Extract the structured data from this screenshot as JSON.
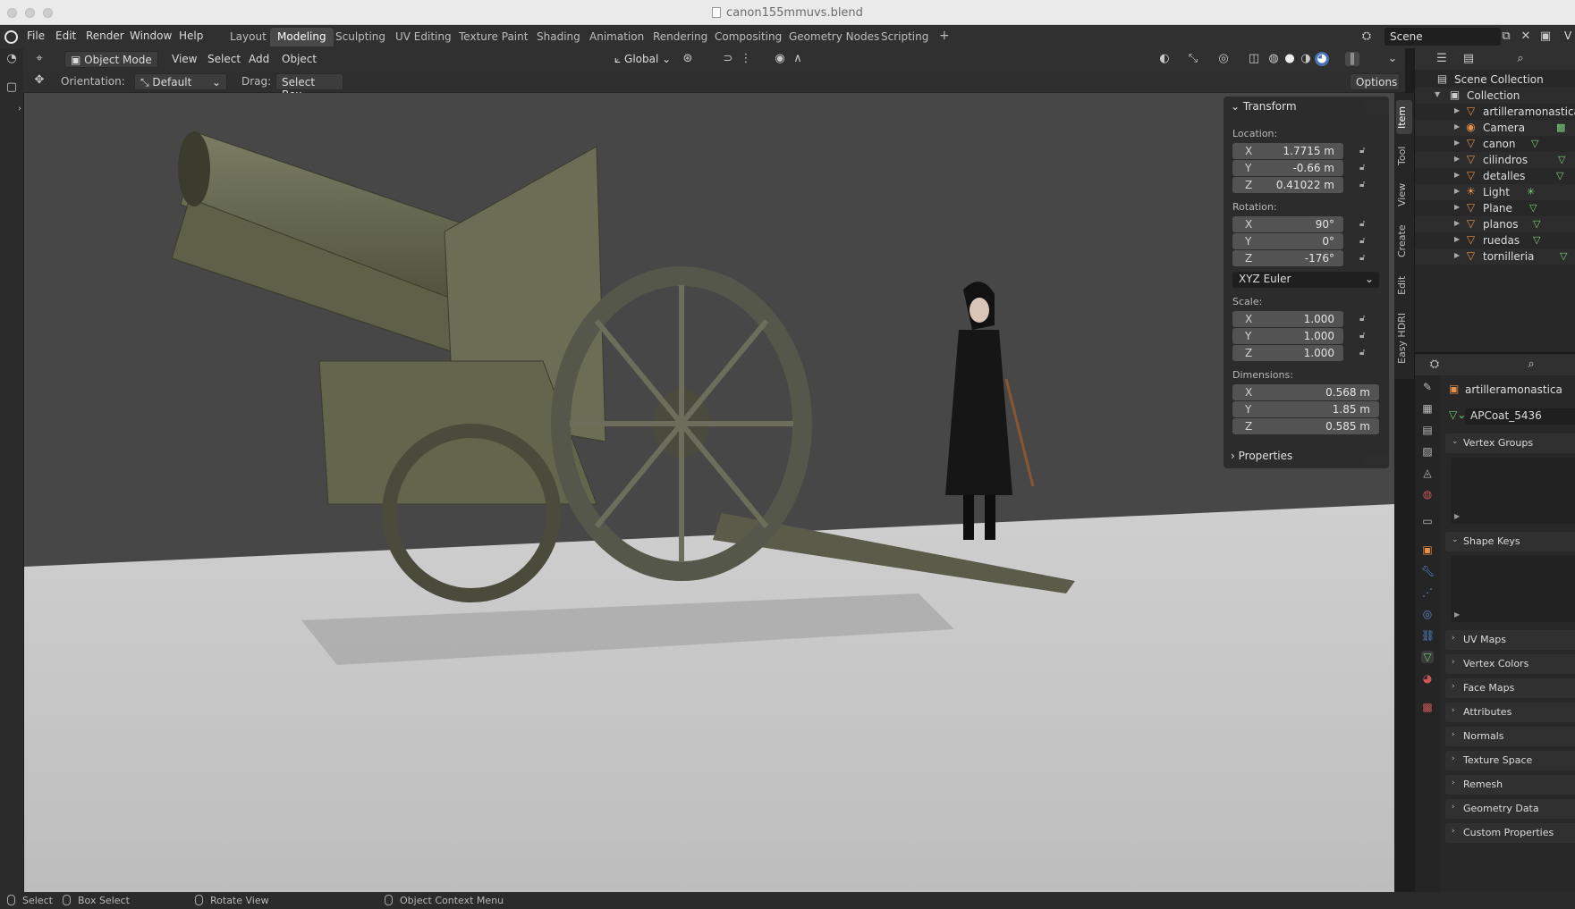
{
  "window": {
    "title": "canon155mmuvs.blend"
  },
  "menus": [
    "File",
    "Edit",
    "Render",
    "Window",
    "Help"
  ],
  "workspaces": [
    {
      "label": "Layout",
      "active": false
    },
    {
      "label": "Modeling",
      "active": true
    },
    {
      "label": "Sculpting",
      "active": false
    },
    {
      "label": "UV Editing",
      "active": false
    },
    {
      "label": "Texture Paint",
      "active": false
    },
    {
      "label": "Shading",
      "active": false
    },
    {
      "label": "Animation",
      "active": false
    },
    {
      "label": "Rendering",
      "active": false
    },
    {
      "label": "Compositing",
      "active": false
    },
    {
      "label": "Geometry Nodes",
      "active": false
    },
    {
      "label": "Scripting",
      "active": false
    }
  ],
  "workspace_add": "+",
  "scene": {
    "name": "Scene",
    "viewlayer_abbr": "V"
  },
  "header": {
    "mode": "Object Mode",
    "menu": [
      "View",
      "Select",
      "Add",
      "Object"
    ],
    "transform_orientation": "Global"
  },
  "tool_settings": {
    "orientation_label": "Orientation:",
    "orientation_value": "Default",
    "drag_label": "Drag:",
    "drag_value": "Select Box",
    "options": "Options"
  },
  "npanel": {
    "transform_title": "Transform",
    "location_label": "Location:",
    "location": [
      {
        "axis": "X",
        "value": "1.7715 m"
      },
      {
        "axis": "Y",
        "value": "-0.66 m"
      },
      {
        "axis": "Z",
        "value": "0.41022 m"
      }
    ],
    "rotation_label": "Rotation:",
    "rotation": [
      {
        "axis": "X",
        "value": "90°"
      },
      {
        "axis": "Y",
        "value": "0°"
      },
      {
        "axis": "Z",
        "value": "-176°"
      }
    ],
    "rotation_mode": "XYZ Euler",
    "scale_label": "Scale:",
    "scale": [
      {
        "axis": "X",
        "value": "1.000"
      },
      {
        "axis": "Y",
        "value": "1.000"
      },
      {
        "axis": "Z",
        "value": "1.000"
      }
    ],
    "dimensions_label": "Dimensions:",
    "dimensions": [
      {
        "axis": "X",
        "value": "0.568 m"
      },
      {
        "axis": "Y",
        "value": "1.85 m"
      },
      {
        "axis": "Z",
        "value": "0.585 m"
      }
    ],
    "properties_title": "Properties"
  },
  "sidebar_tabs": [
    {
      "label": "Item",
      "active": true
    },
    {
      "label": "Tool",
      "active": false
    },
    {
      "label": "View",
      "active": false
    },
    {
      "label": "Create",
      "active": false
    },
    {
      "label": "Edit",
      "active": false
    },
    {
      "label": "Easy HDRI",
      "active": false
    }
  ],
  "outliner": {
    "scene_collection": "Scene Collection",
    "collection": "Collection",
    "items": [
      {
        "name": "artilleramonastica",
        "type": "mesh"
      },
      {
        "name": "Camera",
        "type": "camera"
      },
      {
        "name": "canon",
        "type": "mesh"
      },
      {
        "name": "cilindros",
        "type": "mesh"
      },
      {
        "name": "detalles",
        "type": "mesh"
      },
      {
        "name": "Light",
        "type": "light"
      },
      {
        "name": "Plane",
        "type": "mesh"
      },
      {
        "name": "planos",
        "type": "mesh"
      },
      {
        "name": "ruedas",
        "type": "mesh"
      },
      {
        "name": "tornilleria",
        "type": "mesh"
      }
    ]
  },
  "properties": {
    "object_name": "artilleramonastica",
    "mesh_name": "APCoat_5436",
    "sections_open": [
      "Vertex Groups",
      "Shape Keys"
    ],
    "sections_closed": [
      "UV Maps",
      "Vertex Colors",
      "Face Maps",
      "Attributes",
      "Normals",
      "Texture Space",
      "Remesh",
      "Geometry Data",
      "Custom Properties"
    ]
  },
  "statusbar": {
    "select": "Select",
    "box_select": "Box Select",
    "rotate_view": "Rotate View",
    "context_menu": "Object Context Menu"
  },
  "colors": {
    "accent": "#4772b3",
    "mesh_icon": "#e5904a",
    "data_icon": "#6fcf6f",
    "viewport_bg": "#474747",
    "floor": "#d8d8d8"
  }
}
